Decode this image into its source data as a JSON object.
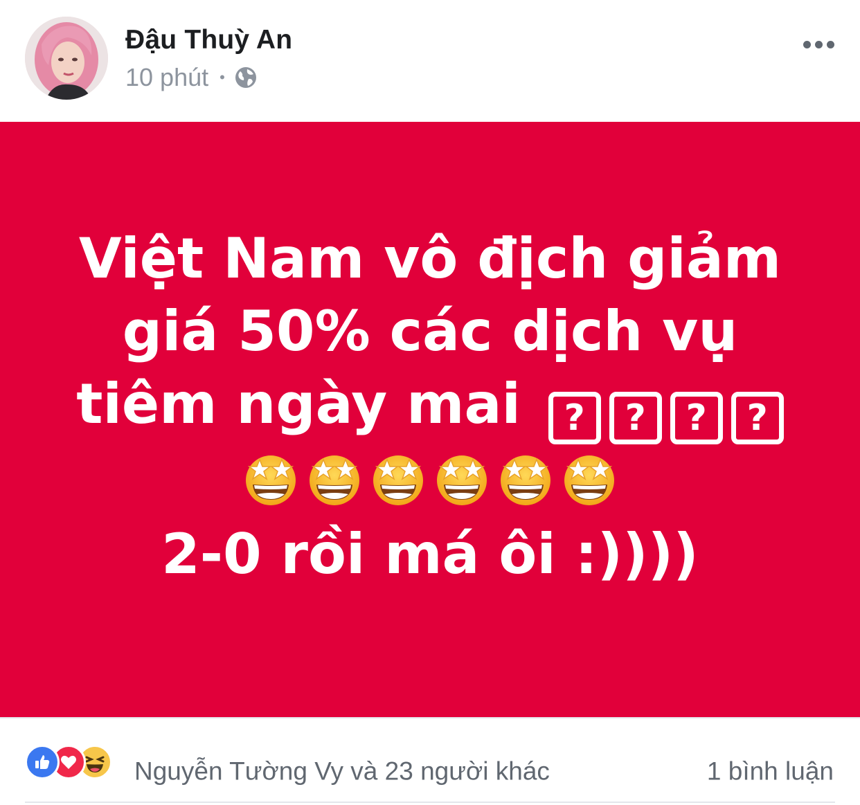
{
  "post": {
    "author_name": "Đậu Thuỳ An",
    "time": "10 phút",
    "separator": "•",
    "privacy_icon": "globe-icon",
    "more_icon": "more-options-icon"
  },
  "status": {
    "background_color": "#e1003a",
    "line1": "Việt Nam vô địch giảm",
    "line2": "giá 50% các dịch vụ",
    "line3": "tiêm ngày mai",
    "unknown_glyph": "?",
    "unknown_glyph_count": 4,
    "emoji_icon": "star-struck-emoji-icon",
    "emoji_count": 6,
    "line5": "2-0 rồi má ôi :))))"
  },
  "footer": {
    "reaction_icons": [
      "like-icon",
      "love-icon",
      "haha-icon"
    ],
    "reaction_text": "Nguyễn Tường Vy và 23 người khác",
    "comment_count": "1 bình luận"
  }
}
